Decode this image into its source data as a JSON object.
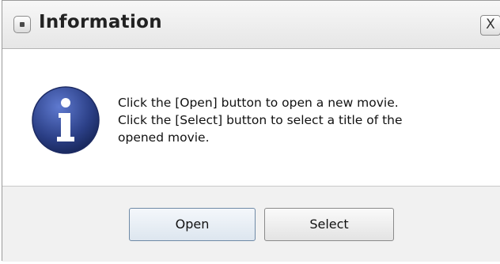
{
  "window": {
    "title": "Information",
    "close_label": "X"
  },
  "message": {
    "lines": [
      "Click the [Open] button to open a new movie.",
      "Click the [Select] button to select a title of the",
      "opened movie."
    ]
  },
  "buttons": {
    "open_label": "Open",
    "select_label": "Select"
  },
  "icons": {
    "title": "window-menu-icon",
    "message": "info-icon"
  },
  "colors": {
    "info_icon": "#2b3f86",
    "focus_border": "#6f8aa6"
  }
}
